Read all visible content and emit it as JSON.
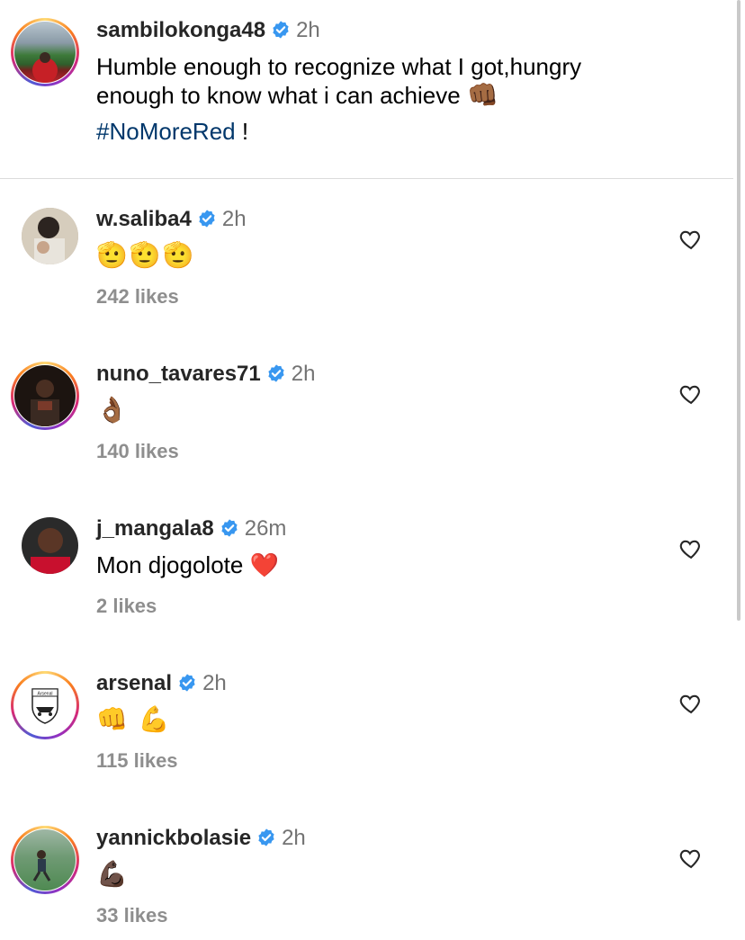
{
  "caption": {
    "username": "sambilokonga48",
    "time": "2h",
    "text_line1": "Humble enough to recognize what I got,hungry",
    "text_line2": "enough to know what i can achieve",
    "emoji": "👊🏾",
    "hashtag": "#NoMoreRed",
    "suffix": " !"
  },
  "comments": [
    {
      "username": "w.saliba4",
      "time": "2h",
      "text": "🫡🫡🫡",
      "likes": "242 likes",
      "ring": false
    },
    {
      "username": "nuno_tavares71",
      "time": "2h",
      "text": "👌🏾",
      "likes": "140 likes",
      "ring": true
    },
    {
      "username": "j_mangala8",
      "time": "26m",
      "text": "Mon djogolote ❤️",
      "likes": "2 likes",
      "ring": false
    },
    {
      "username": "arsenal",
      "time": "2h",
      "text": "👊 💪",
      "likes": "115 likes",
      "ring": true
    },
    {
      "username": "yannickbolasie",
      "time": "2h",
      "text": "💪🏿",
      "likes": "33 likes",
      "ring": true
    }
  ],
  "icons": {
    "verified": "verified-badge-icon",
    "like": "heart-outline-icon"
  },
  "colors": {
    "verified": "#3897f0",
    "hashtag": "#00376b",
    "meta": "#737373",
    "likes": "#8e8e8e"
  },
  "avatar_logo_text": "Arsenal"
}
